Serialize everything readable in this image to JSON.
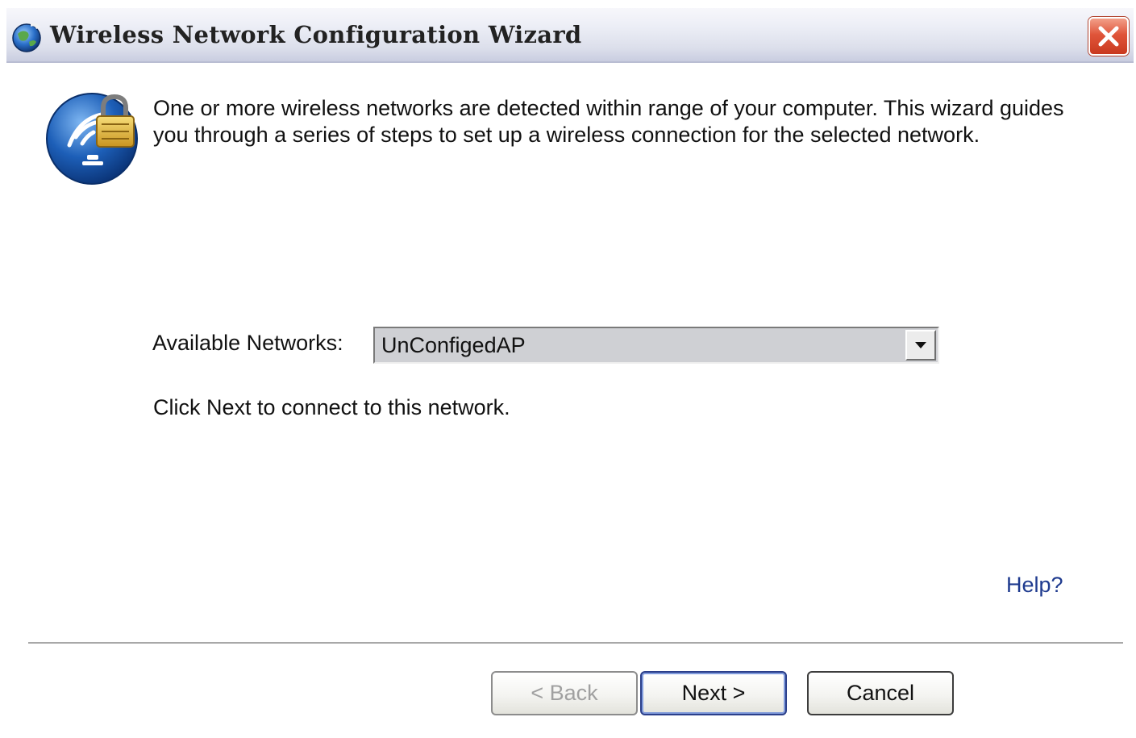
{
  "window": {
    "title": "Wireless Network Configuration Wizard"
  },
  "intro": {
    "text": "One or more wireless networks are detected within range of your computer. This wizard guides you through a series of steps to set up a wireless connection for the selected network."
  },
  "networks": {
    "label": "Available Networks:",
    "selected": "UnConfigedAP"
  },
  "hint": "Click Next to connect to this network.",
  "help_label": "Help?",
  "buttons": {
    "back_label": "< Back",
    "next_label": "Next >",
    "cancel_label": "Cancel"
  },
  "icons": {
    "title": "globe-icon",
    "close": "close-icon",
    "wizard": "wireless-lock-icon",
    "dropdown": "chevron-down-icon"
  },
  "colors": {
    "close_button": "#d9472b",
    "help_link": "#1f3b8f",
    "wizard_icon": "#1d5fb8",
    "lock": "#e3b53a"
  }
}
